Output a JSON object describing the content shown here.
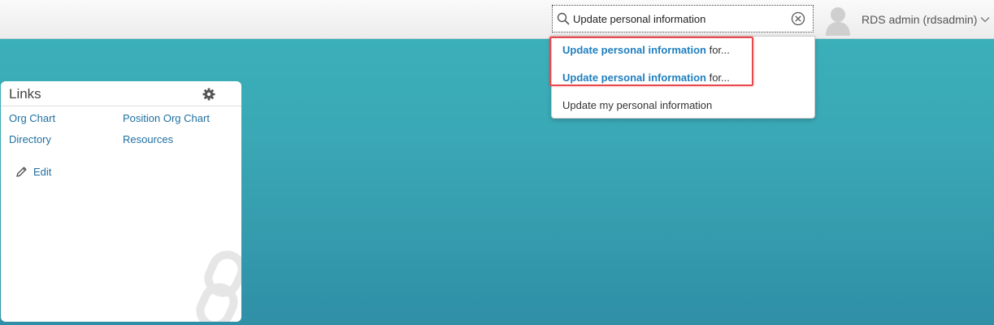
{
  "header": {
    "search": {
      "value": "Update personal information",
      "placeholder": ""
    },
    "user": {
      "name": "RDS admin (rdsadmin)"
    }
  },
  "search_results": {
    "items": [
      {
        "highlight": "Update personal information",
        "suffix": " for..."
      },
      {
        "highlight": "Update personal information",
        "suffix": " for..."
      },
      {
        "highlight": "",
        "suffix": "Update my personal information"
      }
    ]
  },
  "links_card": {
    "title": "Links",
    "links": [
      "Org Chart",
      "Position Org Chart",
      "Directory",
      "Resources"
    ],
    "edit_label": "Edit"
  },
  "colors": {
    "background": "#3aa7b5",
    "link": "#1f6f9f",
    "highlight_text": "#1f7fbf",
    "annotation": "#e8484c"
  },
  "icons": [
    "search-icon",
    "clear-icon",
    "avatar-icon",
    "chevron-down-icon",
    "gear-icon",
    "pencil-icon",
    "link-chain-icon"
  ]
}
